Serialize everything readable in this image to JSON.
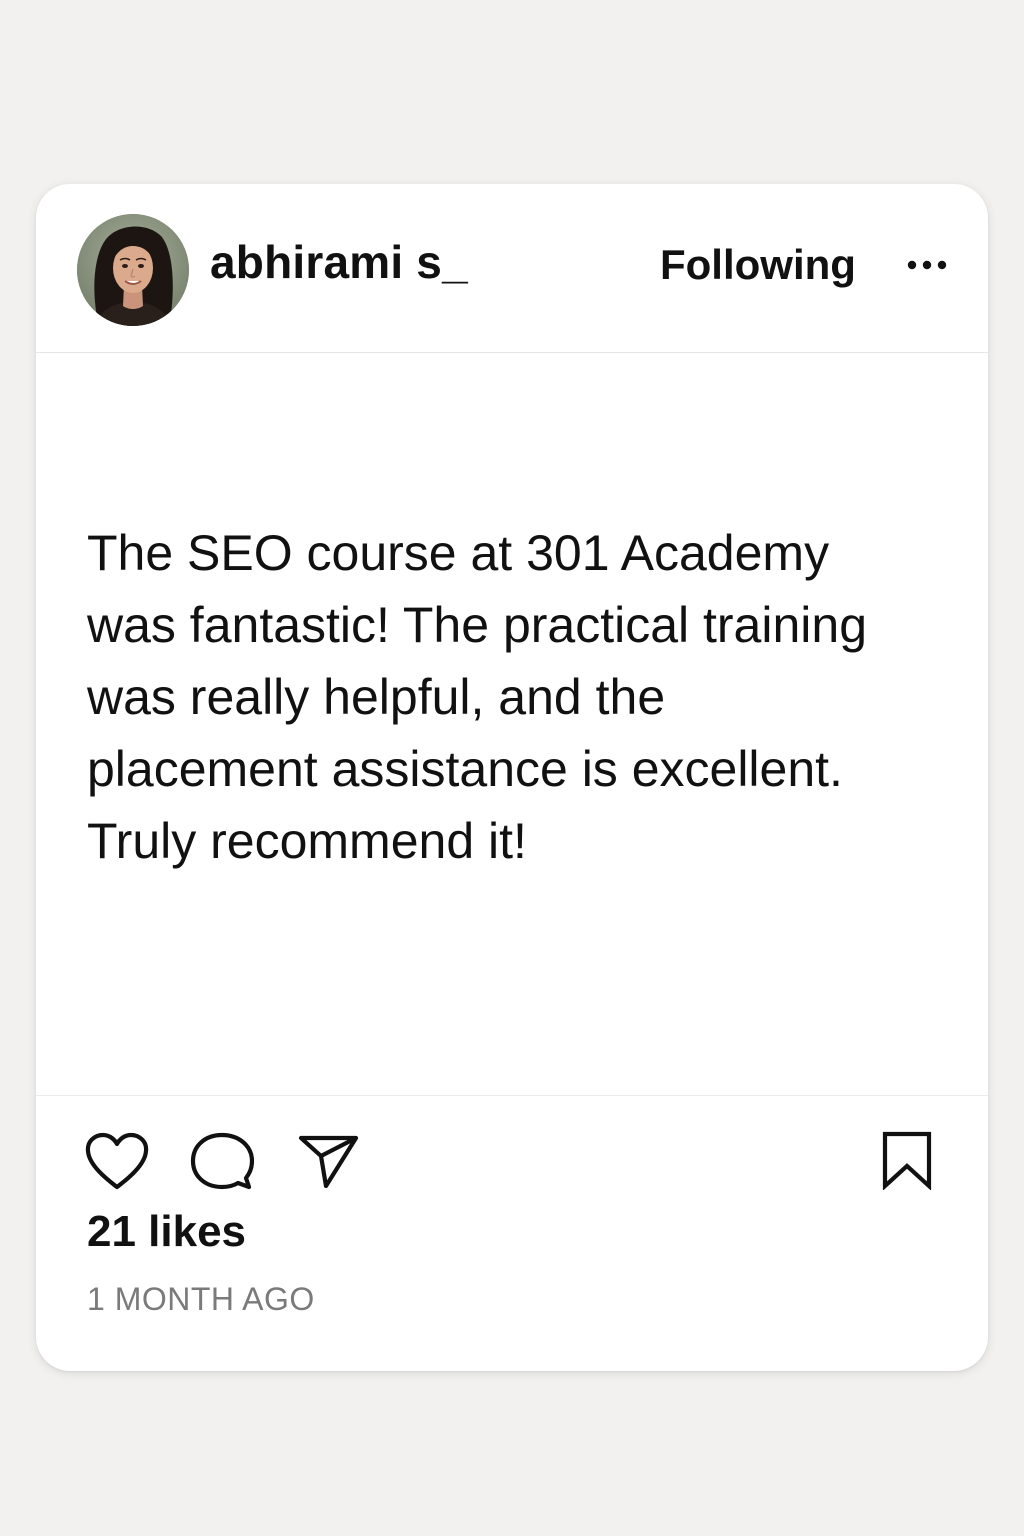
{
  "post": {
    "author": {
      "username": "abhirami s_",
      "avatar_icon": "profile-photo"
    },
    "follow_label": "Following",
    "more_icon": "more-horizontal-icon",
    "text": "The SEO course at 301 Academy was fantastic! The practical training was really helpful, and the placement assistance is excellent. Truly recommend it!",
    "actions": {
      "like_icon": "heart-icon",
      "comment_icon": "comment-icon",
      "share_icon": "send-icon",
      "save_icon": "bookmark-icon"
    },
    "likes": "21 likes",
    "timestamp": "1 MONTH AGO"
  },
  "colors": {
    "page_background": "#f2f1ef",
    "card_background": "#ffffff",
    "text": "#111111",
    "muted_text": "#7a7a7a"
  }
}
